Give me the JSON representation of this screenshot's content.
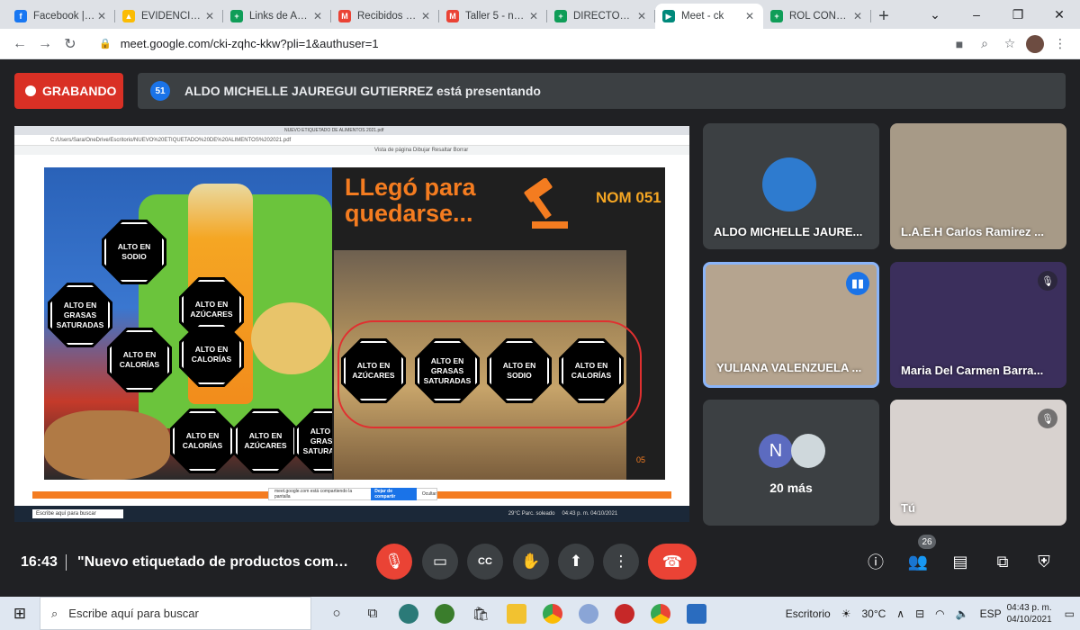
{
  "browser": {
    "tabs": [
      {
        "title": "Facebook | Ent",
        "fav_color": "#1877f2",
        "fav_glyph": "f"
      },
      {
        "title": "EVIDENCIAS D",
        "fav_color": "#fbbc04",
        "fav_glyph": "▲"
      },
      {
        "title": "Links de Asist",
        "fav_color": "#0f9d58",
        "fav_glyph": "+"
      },
      {
        "title": "Recibidos (56)",
        "fav_color": "#ea4335",
        "fav_glyph": "M"
      },
      {
        "title": "Taller 5 - nadi",
        "fav_color": "#ea4335",
        "fav_glyph": "M"
      },
      {
        "title": "DIRECTORIO",
        "fav_color": "#0f9d58",
        "fav_glyph": "+"
      },
      {
        "title": "Meet - ck",
        "fav_color": "#00897b",
        "fav_glyph": "▶"
      },
      {
        "title": "ROL CONFERE",
        "fav_color": "#0f9d58",
        "fav_glyph": "+"
      }
    ],
    "url": "meet.google.com/cki-zqhc-kkw?pli=1&authuser=1"
  },
  "meet": {
    "recording_label": "GRABANDO",
    "presenter_text": "ALDO MICHELLE JAUREGUI GUTIERREZ está presentando",
    "slide": {
      "headline": "LLegó para quedarse...",
      "nom": "NOM 051",
      "page_number": "05",
      "left_labels": [
        "ALTO EN SODIO",
        "ALTO EN GRASAS SATURADAS",
        "ALTO EN AZÚCARES",
        "ALTO EN CALORÍAS",
        "ALTO EN CALORÍAS",
        "ALTO EN CALORÍAS",
        "ALTO EN AZÚCARES",
        "ALTO EN GRASAS SATURADAS"
      ],
      "right_labels": [
        "ALTO EN AZÚCARES",
        "ALTO EN GRASAS SATURADAS",
        "ALTO EN SODIO",
        "ALTO EN CALORÍAS"
      ],
      "inner_url": "C:/Users/Sara/OneDrive/Escritorio/NUEVO%20ETIQUETADO%20DE%20ALIMENTOS%202021.pdf",
      "inner_tab": "NUEVO ETIQUETADO DE ALIMENTOS 2021.pdf",
      "inner_tool": "Vista de página   Dibujar   Resaltar   Borrar",
      "inner_toast": "meet.google.com está compartiendo la pantalla",
      "inner_toast_btn": "Dejar de compartir",
      "inner_toast_hide": "Ocultar",
      "inner_search": "Escribe aquí para buscar",
      "inner_weather": "29°C  Parc. soleado"
    },
    "participants": [
      {
        "name": "ALDO MICHELLE JAURE...",
        "bg": "#3c4043"
      },
      {
        "name": "L.A.E.H Carlos Ramirez ...",
        "bg": "#a79a87"
      },
      {
        "name": "YULIANA VALENZUELA ...",
        "bg": "#b5a48f"
      },
      {
        "name": "Maria Del Carmen Barra...",
        "bg": "#3b2f5c"
      },
      {
        "name": "20 más",
        "initial": "N"
      },
      {
        "name": "Tú",
        "bg": "#d8d2cf"
      }
    ],
    "time": "16:43",
    "meeting_title": "\"Nuevo etiquetado de productos comes...",
    "participant_count": "26"
  },
  "taskbar": {
    "search_placeholder": "Escribe aquí para buscar",
    "desktop_label": "Escritorio",
    "temperature": "30°C",
    "language": "ESP",
    "clock_time": "04:43 p. m.",
    "clock_date": "04/10/2021",
    "inner_clock": "04:43 p. m. 04/10/2021"
  }
}
